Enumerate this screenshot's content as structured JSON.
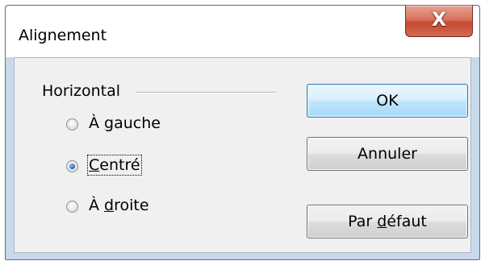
{
  "window": {
    "title": "Alignement",
    "close_glyph": "X"
  },
  "group": {
    "label": "Horizontal"
  },
  "options": [
    {
      "prefix": "À ",
      "accel": "g",
      "rest": "auche",
      "checked": false
    },
    {
      "prefix": "",
      "accel": "C",
      "rest": "entré",
      "checked": true
    },
    {
      "prefix": "À ",
      "accel": "d",
      "rest": "roite",
      "checked": false
    }
  ],
  "buttons": {
    "ok": {
      "label": "OK"
    },
    "cancel": {
      "label": "Annuler"
    },
    "default": {
      "prefix": "Par ",
      "accel": "d",
      "rest": "éfaut"
    }
  },
  "icons": {
    "close": "close-icon",
    "radio": "radio-icon"
  }
}
